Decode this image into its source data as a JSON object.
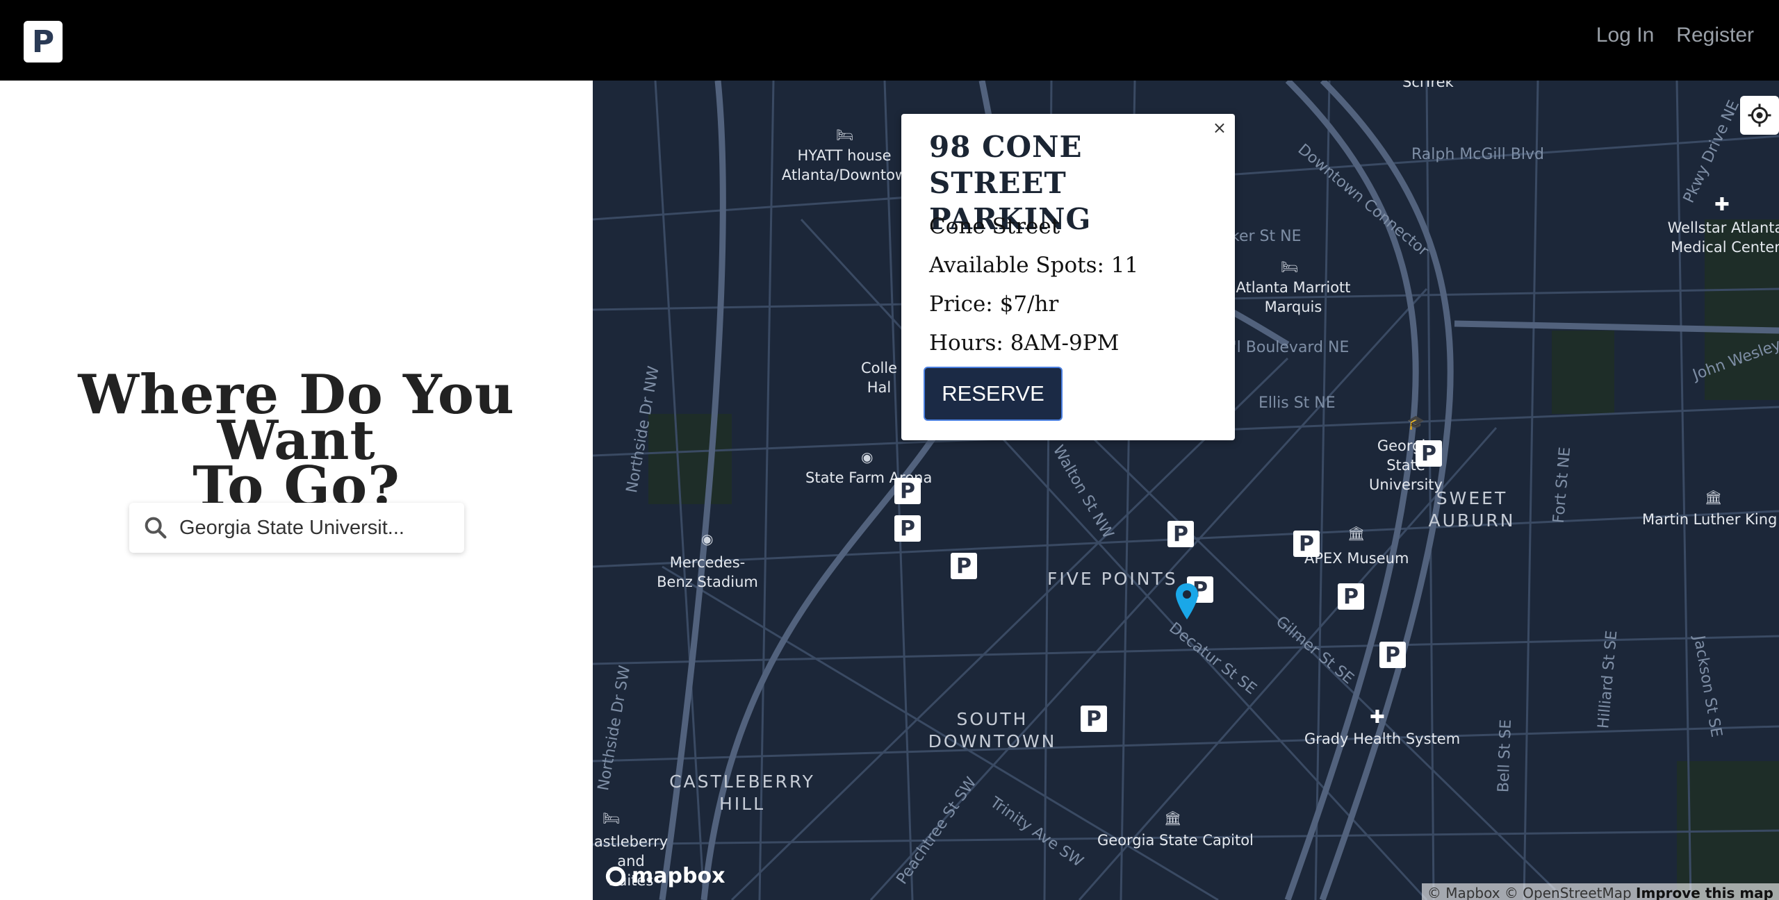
{
  "header": {
    "logo_letter": "P",
    "login": "Log In",
    "register": "Register"
  },
  "hero": {
    "line1": "Where Do You Want",
    "line2": "To Go?"
  },
  "search": {
    "value": "Georgia State Universit..."
  },
  "popup": {
    "close": "×",
    "title": "98 CONE STREET PARKING",
    "street": "Cone Street",
    "spots": "Available Spots: 11",
    "price": "Price: $7/hr",
    "hours": "Hours: 8AM-9PM",
    "reserve": "RESERVE"
  },
  "map": {
    "labels": {
      "hyatt": "HYATT house Atlanta/Downtow",
      "marriott": "Atlanta Marriott Marquis",
      "college": "Colle Hal",
      "statefarm": "State Farm Arena",
      "mercedes": "Mercedes-Benz Stadium",
      "fivepoints": "FIVE POINTS",
      "southdowntown": "SOUTH DOWNTOWN",
      "castleberry": "CASTLEBERRY HILL",
      "suites": "astleberry and Suites",
      "gsu": "Georgia State University",
      "sweetauburn": "SWEET AUBURN",
      "apex": "APEX Museum",
      "grady": "Grady Health System",
      "capitol": "Georgia State Capitol",
      "wellstar": "Wellstar Atlanta Medical Center",
      "mlk": "Martin Luther King",
      "scitrek": "SciTrek",
      "ralph": "Ralph McGill Blvd",
      "connector": "Downtown Connector",
      "ker": "ker St NE",
      "boulevard": "t'l Boulevard NE",
      "ellis": "Ellis St NE",
      "decatur": "Decatur St SE",
      "gilmer": "Gilmer St SE",
      "walton": "Walton St NW",
      "peachtree": "Peachtree St SW",
      "trinity": "Trinity Ave SW",
      "northside": "Northside Dr NW",
      "northside_sw": "Northside Dr SW",
      "fort": "Fort St NE",
      "bell": "Bell St SE",
      "hilliard": "Hilliard St SE",
      "jackson": "Jackson St SE",
      "johnwesley": "John Wesley",
      "parkway": "Pkwy Drive NE"
    },
    "parking_letter": "P",
    "mapbox": "mapbox",
    "attribution_a": "© Mapbox © OpenStreetMap",
    "attribution_b": "Improve this map"
  }
}
